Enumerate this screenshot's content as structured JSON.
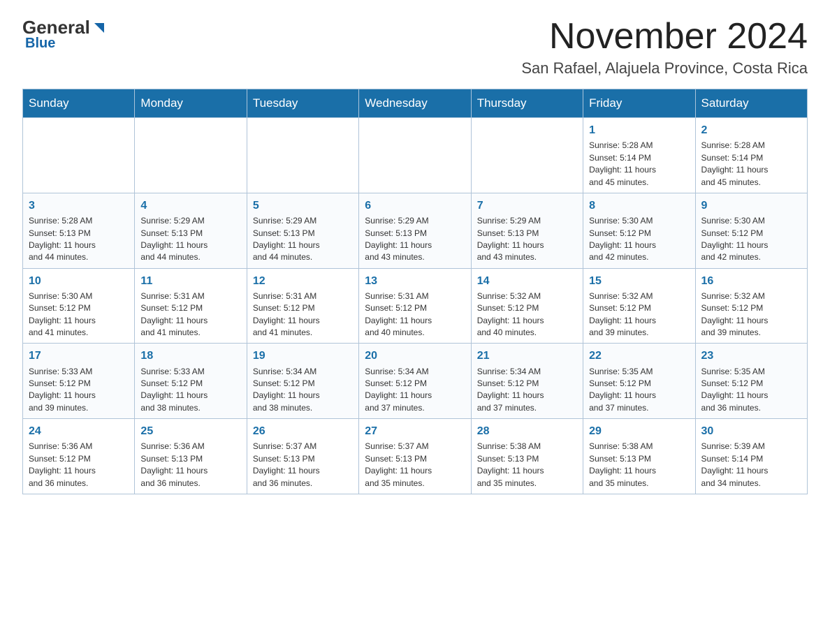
{
  "logo": {
    "general": "General",
    "blue_text": "Blue",
    "triangle_symbol": "▶"
  },
  "title": "November 2024",
  "subtitle": "San Rafael, Alajuela Province, Costa Rica",
  "days_of_week": [
    "Sunday",
    "Monday",
    "Tuesday",
    "Wednesday",
    "Thursday",
    "Friday",
    "Saturday"
  ],
  "weeks": [
    {
      "days": [
        {
          "number": "",
          "info": ""
        },
        {
          "number": "",
          "info": ""
        },
        {
          "number": "",
          "info": ""
        },
        {
          "number": "",
          "info": ""
        },
        {
          "number": "",
          "info": ""
        },
        {
          "number": "1",
          "info": "Sunrise: 5:28 AM\nSunset: 5:14 PM\nDaylight: 11 hours\nand 45 minutes."
        },
        {
          "number": "2",
          "info": "Sunrise: 5:28 AM\nSunset: 5:14 PM\nDaylight: 11 hours\nand 45 minutes."
        }
      ]
    },
    {
      "days": [
        {
          "number": "3",
          "info": "Sunrise: 5:28 AM\nSunset: 5:13 PM\nDaylight: 11 hours\nand 44 minutes."
        },
        {
          "number": "4",
          "info": "Sunrise: 5:29 AM\nSunset: 5:13 PM\nDaylight: 11 hours\nand 44 minutes."
        },
        {
          "number": "5",
          "info": "Sunrise: 5:29 AM\nSunset: 5:13 PM\nDaylight: 11 hours\nand 44 minutes."
        },
        {
          "number": "6",
          "info": "Sunrise: 5:29 AM\nSunset: 5:13 PM\nDaylight: 11 hours\nand 43 minutes."
        },
        {
          "number": "7",
          "info": "Sunrise: 5:29 AM\nSunset: 5:13 PM\nDaylight: 11 hours\nand 43 minutes."
        },
        {
          "number": "8",
          "info": "Sunrise: 5:30 AM\nSunset: 5:12 PM\nDaylight: 11 hours\nand 42 minutes."
        },
        {
          "number": "9",
          "info": "Sunrise: 5:30 AM\nSunset: 5:12 PM\nDaylight: 11 hours\nand 42 minutes."
        }
      ]
    },
    {
      "days": [
        {
          "number": "10",
          "info": "Sunrise: 5:30 AM\nSunset: 5:12 PM\nDaylight: 11 hours\nand 41 minutes."
        },
        {
          "number": "11",
          "info": "Sunrise: 5:31 AM\nSunset: 5:12 PM\nDaylight: 11 hours\nand 41 minutes."
        },
        {
          "number": "12",
          "info": "Sunrise: 5:31 AM\nSunset: 5:12 PM\nDaylight: 11 hours\nand 41 minutes."
        },
        {
          "number": "13",
          "info": "Sunrise: 5:31 AM\nSunset: 5:12 PM\nDaylight: 11 hours\nand 40 minutes."
        },
        {
          "number": "14",
          "info": "Sunrise: 5:32 AM\nSunset: 5:12 PM\nDaylight: 11 hours\nand 40 minutes."
        },
        {
          "number": "15",
          "info": "Sunrise: 5:32 AM\nSunset: 5:12 PM\nDaylight: 11 hours\nand 39 minutes."
        },
        {
          "number": "16",
          "info": "Sunrise: 5:32 AM\nSunset: 5:12 PM\nDaylight: 11 hours\nand 39 minutes."
        }
      ]
    },
    {
      "days": [
        {
          "number": "17",
          "info": "Sunrise: 5:33 AM\nSunset: 5:12 PM\nDaylight: 11 hours\nand 39 minutes."
        },
        {
          "number": "18",
          "info": "Sunrise: 5:33 AM\nSunset: 5:12 PM\nDaylight: 11 hours\nand 38 minutes."
        },
        {
          "number": "19",
          "info": "Sunrise: 5:34 AM\nSunset: 5:12 PM\nDaylight: 11 hours\nand 38 minutes."
        },
        {
          "number": "20",
          "info": "Sunrise: 5:34 AM\nSunset: 5:12 PM\nDaylight: 11 hours\nand 37 minutes."
        },
        {
          "number": "21",
          "info": "Sunrise: 5:34 AM\nSunset: 5:12 PM\nDaylight: 11 hours\nand 37 minutes."
        },
        {
          "number": "22",
          "info": "Sunrise: 5:35 AM\nSunset: 5:12 PM\nDaylight: 11 hours\nand 37 minutes."
        },
        {
          "number": "23",
          "info": "Sunrise: 5:35 AM\nSunset: 5:12 PM\nDaylight: 11 hours\nand 36 minutes."
        }
      ]
    },
    {
      "days": [
        {
          "number": "24",
          "info": "Sunrise: 5:36 AM\nSunset: 5:12 PM\nDaylight: 11 hours\nand 36 minutes."
        },
        {
          "number": "25",
          "info": "Sunrise: 5:36 AM\nSunset: 5:13 PM\nDaylight: 11 hours\nand 36 minutes."
        },
        {
          "number": "26",
          "info": "Sunrise: 5:37 AM\nSunset: 5:13 PM\nDaylight: 11 hours\nand 36 minutes."
        },
        {
          "number": "27",
          "info": "Sunrise: 5:37 AM\nSunset: 5:13 PM\nDaylight: 11 hours\nand 35 minutes."
        },
        {
          "number": "28",
          "info": "Sunrise: 5:38 AM\nSunset: 5:13 PM\nDaylight: 11 hours\nand 35 minutes."
        },
        {
          "number": "29",
          "info": "Sunrise: 5:38 AM\nSunset: 5:13 PM\nDaylight: 11 hours\nand 35 minutes."
        },
        {
          "number": "30",
          "info": "Sunrise: 5:39 AM\nSunset: 5:14 PM\nDaylight: 11 hours\nand 34 minutes."
        }
      ]
    }
  ]
}
